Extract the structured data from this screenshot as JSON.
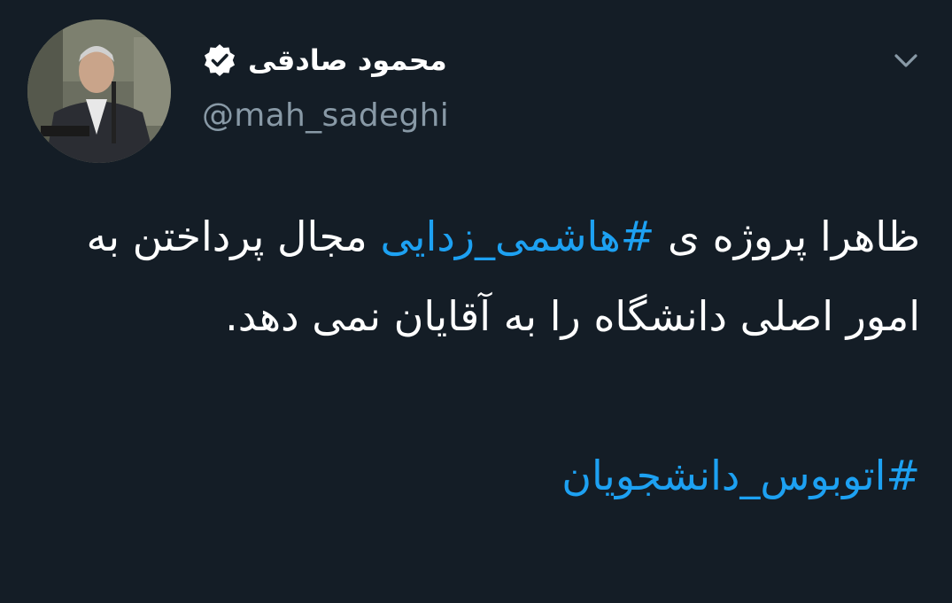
{
  "author": {
    "display_name": "محمود صادقی",
    "handle": "@mah_sadeghi",
    "verified": true
  },
  "icons": {
    "verified": "verified-badge-icon",
    "menu": "chevron-down-icon"
  },
  "tweet": {
    "line1_before": "ظاهرا پروژه ی ",
    "hashtag1": "#هاشمی_زدایی",
    "line1_after": " مجال",
    "body": "پرداختن به امور اصلی دانشگاه را به آقایان نمی دهد.",
    "hashtag2": "#اتوبوس_دانشجویان"
  },
  "colors": {
    "background": "#141d26",
    "text": "#ffffff",
    "secondary": "#8899a6",
    "link": "#1da1f2"
  }
}
